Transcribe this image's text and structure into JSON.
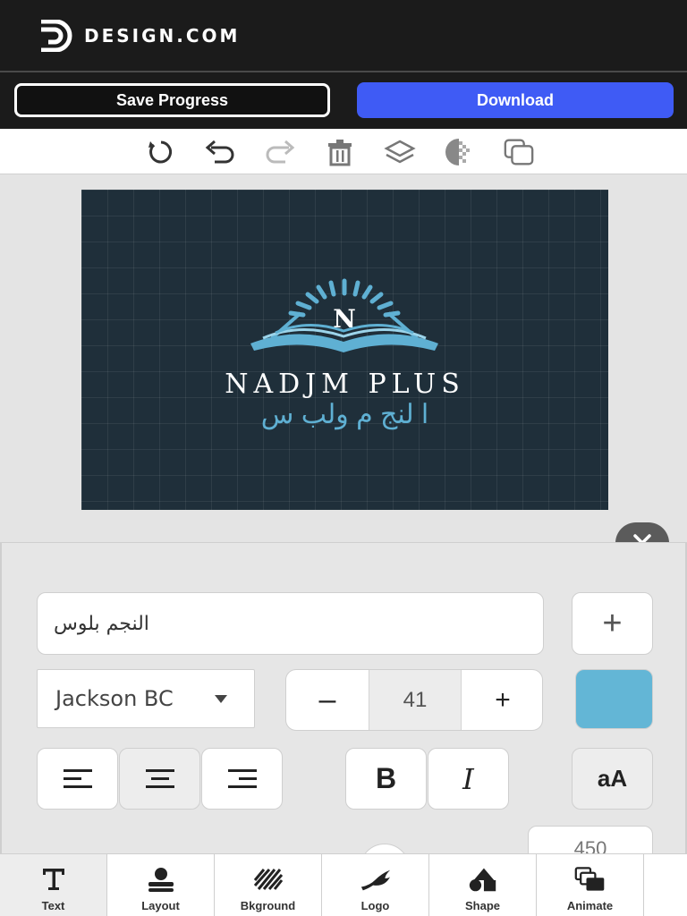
{
  "brand": {
    "name": "DESIGN.COM"
  },
  "actions": {
    "save_label": "Save Progress",
    "download_label": "Download"
  },
  "toolbar": {
    "icons": [
      "reset-icon",
      "undo-icon",
      "redo-icon",
      "trash-icon",
      "layers-icon",
      "transparency-icon",
      "duplicate-icon"
    ]
  },
  "design": {
    "emblem_letter": "N",
    "title": "NADJM PLUS",
    "subtitle": "ا لنج م ولب س",
    "colors": {
      "background": "#1f2f3a",
      "accent": "#5fb0d3",
      "title": "#ffffff"
    }
  },
  "editor": {
    "text_value": "النجم بلوس",
    "add_label": "+",
    "font_name": "Jackson BC",
    "size_minus": "–",
    "font_size": "41",
    "size_plus": "+",
    "color": "#63b6d6",
    "bold_label": "B",
    "italic_label": "I",
    "case_label": "aA",
    "partial_value": "450"
  },
  "bottom_nav": [
    {
      "label": "Text",
      "icon": "text-icon",
      "active": true
    },
    {
      "label": "Layout",
      "icon": "layout-icon"
    },
    {
      "label": "Bkground",
      "icon": "background-icon"
    },
    {
      "label": "Logo",
      "icon": "logo-icon"
    },
    {
      "label": "Shape",
      "icon": "shape-icon"
    },
    {
      "label": "Animate",
      "icon": "animate-icon"
    }
  ]
}
